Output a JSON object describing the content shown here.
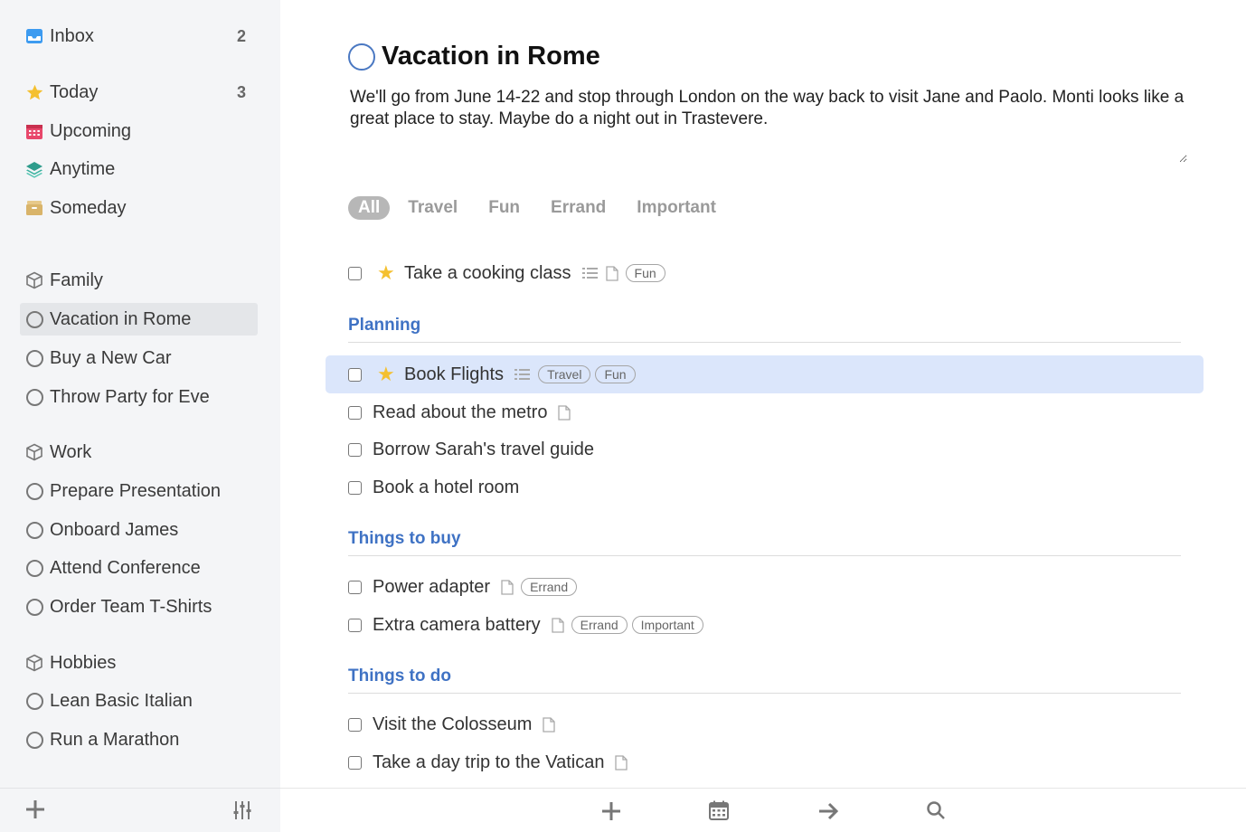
{
  "sidebar": {
    "inbox": {
      "label": "Inbox",
      "count": "2",
      "icon": "inbox-icon"
    },
    "today": {
      "label": "Today",
      "count": "3",
      "icon": "star-icon"
    },
    "upcoming": {
      "label": "Upcoming",
      "icon": "calendar-icon"
    },
    "anytime": {
      "label": "Anytime",
      "icon": "layers-icon"
    },
    "someday": {
      "label": "Someday",
      "icon": "archive-box-icon"
    },
    "areas": [
      {
        "label": "Family",
        "projects": [
          "Vacation in Rome",
          "Buy a New Car",
          "Throw Party for Eve"
        ]
      },
      {
        "label": "Work",
        "projects": [
          "Prepare Presentation",
          "Onboard James",
          "Attend Conference",
          "Order Team T-Shirts"
        ]
      },
      {
        "label": "Hobbies",
        "projects": [
          "Lean Basic Italian",
          "Run a Marathon"
        ]
      }
    ],
    "selected_project": "Vacation in Rome"
  },
  "project": {
    "title": "Vacation in Rome",
    "notes": "We'll go from June 14-22 and stop through London on the way back to visit Jane and Paolo. Monti looks like a great place to stay. Maybe do a night out in Trastevere."
  },
  "filters": [
    "All",
    "Travel",
    "Fun",
    "Errand",
    "Important"
  ],
  "active_filter": "All",
  "loose_tasks": [
    {
      "label": "Take a cooking class",
      "starred": true,
      "checklist": true,
      "note": true,
      "tags": [
        "Fun"
      ]
    }
  ],
  "headings": [
    {
      "label": "Planning",
      "tasks": [
        {
          "label": "Book Flights",
          "starred": true,
          "checklist": true,
          "note": false,
          "tags": [
            "Travel",
            "Fun"
          ],
          "selected": true
        },
        {
          "label": "Read about the metro",
          "note": true,
          "tags": []
        },
        {
          "label": "Borrow Sarah's travel guide",
          "tags": []
        },
        {
          "label": "Book a hotel room",
          "tags": []
        }
      ]
    },
    {
      "label": "Things to buy",
      "tasks": [
        {
          "label": "Power adapter",
          "note": true,
          "tags": [
            "Errand"
          ]
        },
        {
          "label": "Extra camera battery",
          "note": true,
          "tags": [
            "Errand",
            "Important"
          ]
        }
      ]
    },
    {
      "label": "Things to do",
      "tasks": [
        {
          "label": "Visit the Colosseum",
          "note": true,
          "tags": []
        },
        {
          "label": "Take a day trip to the Vatican",
          "note": true,
          "tags": []
        }
      ]
    }
  ],
  "colors": {
    "accent": "#3f72c4",
    "star": "#f4c030",
    "selected_row": "#dbe6fb",
    "sidebar_bg": "#f4f5f7"
  }
}
